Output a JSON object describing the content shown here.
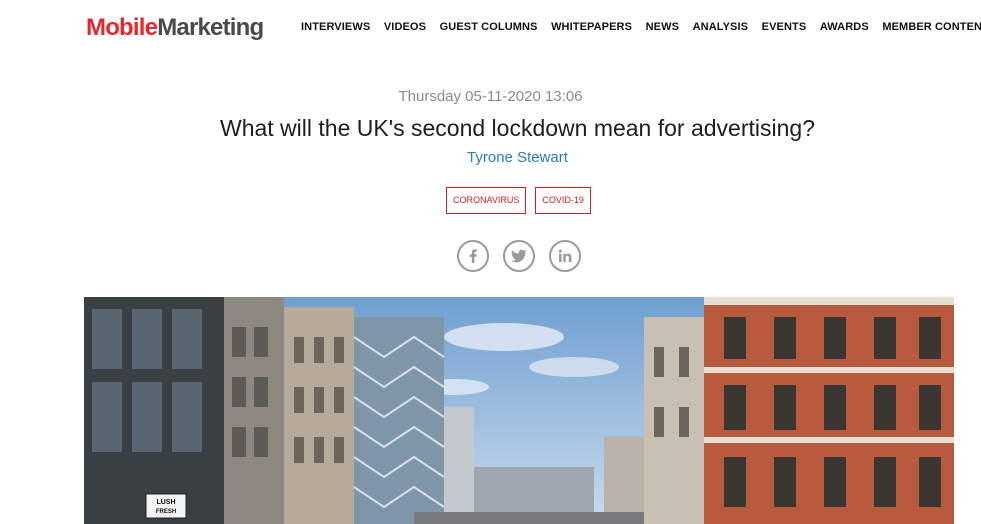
{
  "brand": {
    "part1": "Mobile",
    "part2": "Marketing",
    "primary_color": "#e8262d",
    "secondary_color": "#4a4a4a"
  },
  "nav": {
    "items": [
      "INTERVIEWS",
      "VIDEOS",
      "GUEST COLUMNS",
      "WHITEPAPERS",
      "NEWS",
      "ANALYSIS",
      "EVENTS",
      "AWARDS",
      "MEMBER CONTENT"
    ]
  },
  "article": {
    "date": "Thursday 05-11-2020 13:06",
    "title": "What will the UK's second lockdown mean for advertising?",
    "author": "Tyrone Stewart",
    "tags": [
      "CORONAVIRUS",
      "COVID-19"
    ],
    "tag_color": "#d11f25",
    "author_color": "#2a7fb5"
  },
  "social": {
    "icons": [
      "facebook-icon",
      "twitter-icon",
      "linkedin-icon"
    ]
  },
  "hero_image": {
    "description_icon": "street-photo",
    "sign_text": "LUSH FRESH"
  }
}
